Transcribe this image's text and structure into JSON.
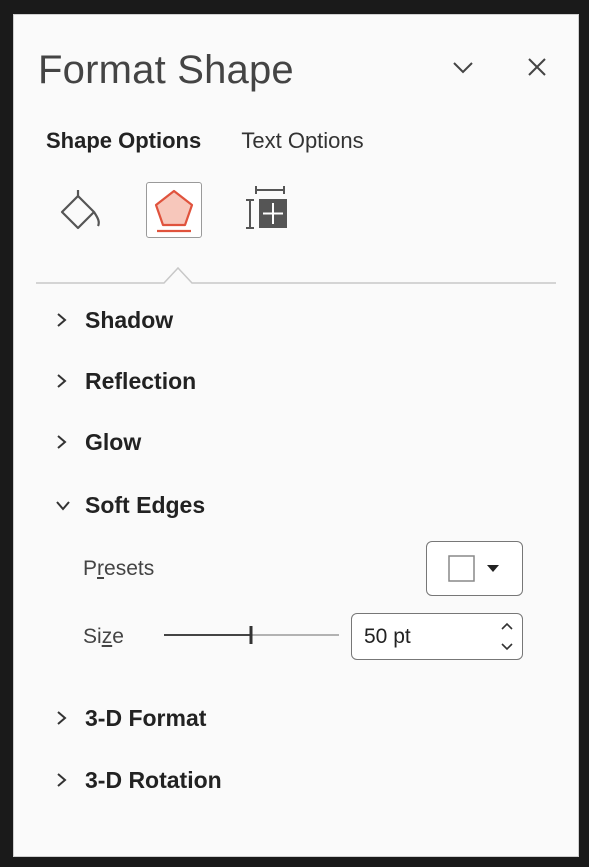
{
  "pane": {
    "title": "Format Shape",
    "collapse_icon": "chevron-down-icon",
    "close_icon": "close-icon"
  },
  "tabs": [
    {
      "label": "Shape Options",
      "active": true
    },
    {
      "label": "Text Options",
      "active": false
    }
  ],
  "icon_tabs": [
    {
      "name": "fill-line-icon",
      "selected": false
    },
    {
      "name": "effects-pentagon-icon",
      "selected": true
    },
    {
      "name": "size-properties-icon",
      "selected": false
    }
  ],
  "sections": {
    "shadow": {
      "label": "Shadow",
      "expanded": false
    },
    "reflection": {
      "label": "Reflection",
      "expanded": false
    },
    "glow": {
      "label": "Glow",
      "expanded": false
    },
    "soft_edges": {
      "label": "Soft Edges",
      "expanded": true,
      "presets_label_pre": "P",
      "presets_label_u": "r",
      "presets_label_post": "esets",
      "size_label_pre": "Si",
      "size_label_u": "z",
      "size_label_post": "e",
      "size_value": "50 pt",
      "size_fraction": 0.5
    },
    "format_3d": {
      "label": "3-D Format",
      "expanded": false
    },
    "rotation_3d": {
      "label": "3-D Rotation",
      "expanded": false
    }
  },
  "colors": {
    "accent": "#e0533d",
    "accent_fill": "#f7c7bb"
  }
}
